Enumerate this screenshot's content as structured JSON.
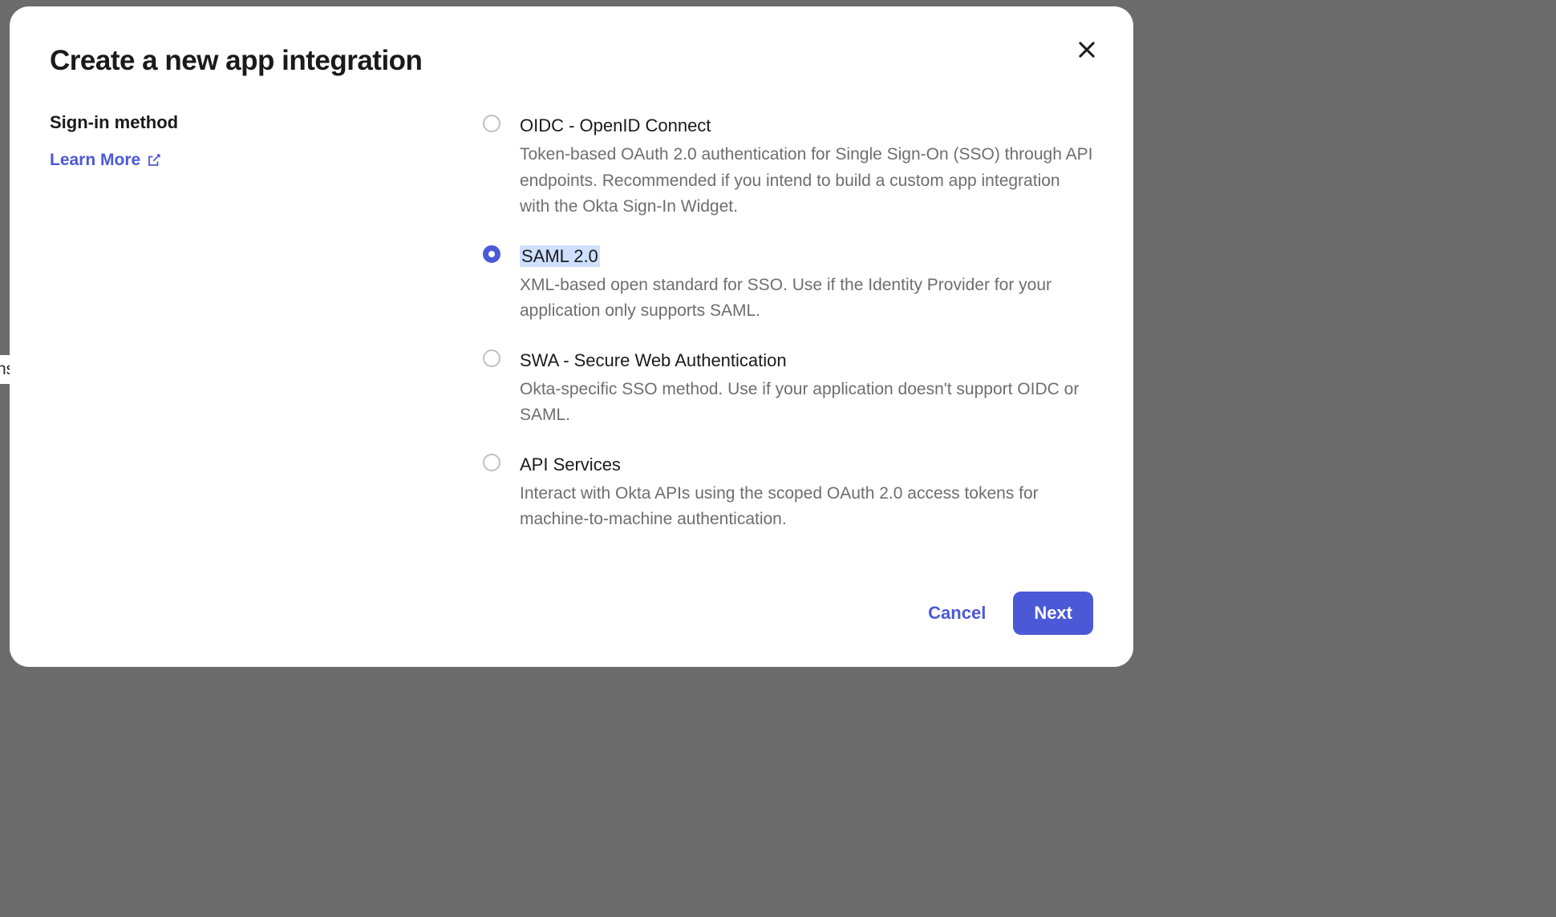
{
  "background": {
    "peek_text": "ns"
  },
  "modal": {
    "title": "Create a new app integration",
    "section_label": "Sign-in method",
    "learn_more_label": "Learn More",
    "options": [
      {
        "id": "oidc",
        "title": "OIDC - OpenID Connect",
        "description": "Token-based OAuth 2.0 authentication for Single Sign-On (SSO) through API endpoints. Recommended if you intend to build a custom app integration with the Okta Sign-In Widget.",
        "selected": false
      },
      {
        "id": "saml",
        "title": "SAML 2.0",
        "description": "XML-based open standard for SSO. Use if the Identity Provider for your application only supports SAML.",
        "selected": true,
        "highlighted_title": true
      },
      {
        "id": "swa",
        "title": "SWA - Secure Web Authentication",
        "description": "Okta-specific SSO method. Use if your application doesn't support OIDC or SAML.",
        "selected": false
      },
      {
        "id": "api",
        "title": "API Services",
        "description": "Interact with Okta APIs using the scoped OAuth 2.0 access tokens for machine-to-machine authentication.",
        "selected": false
      }
    ],
    "buttons": {
      "cancel": "Cancel",
      "next": "Next"
    }
  }
}
